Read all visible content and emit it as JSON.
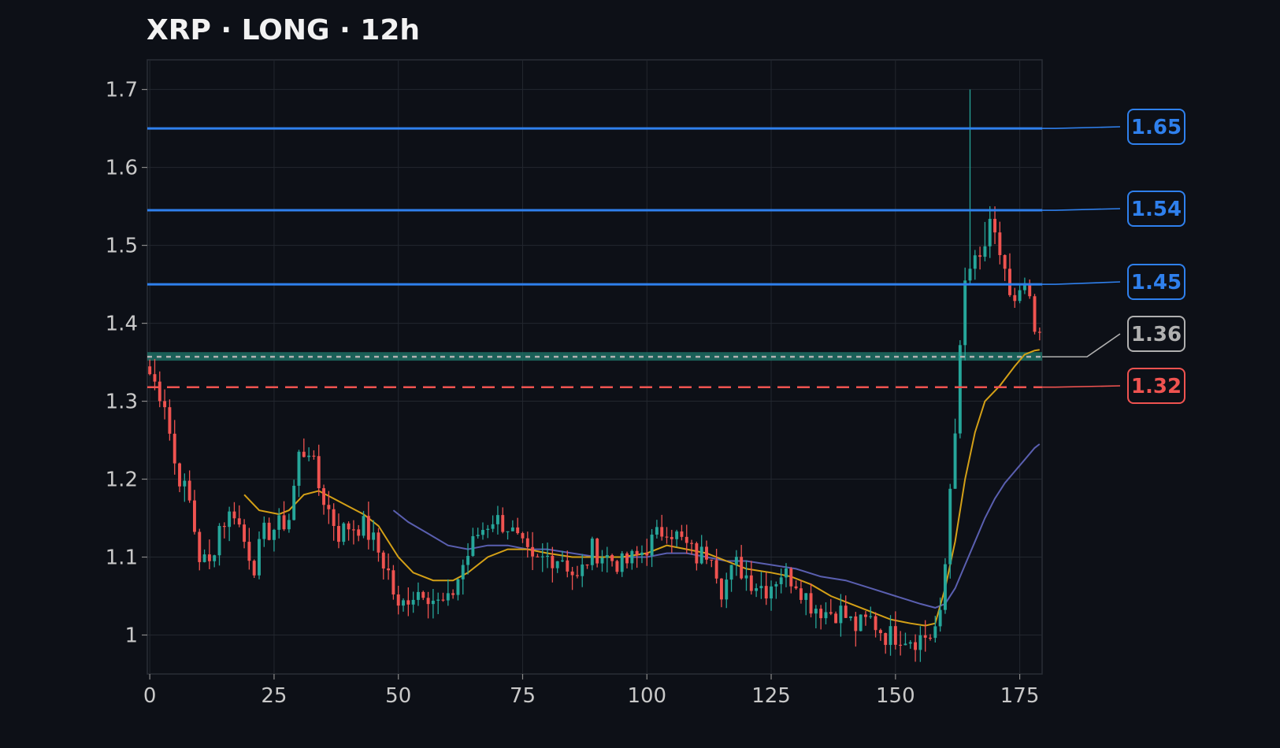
{
  "chart_data": {
    "type": "candlestick",
    "title": "XRP · LONG · 12h",
    "xlabel": "",
    "ylabel": "",
    "xlim": [
      -0.5,
      179.5
    ],
    "ylim": [
      0.95,
      1.738
    ],
    "x_ticks": [
      0,
      25,
      50,
      75,
      100,
      125,
      150,
      175
    ],
    "y_ticks": [
      1,
      1.1,
      1.2,
      1.3,
      1.4,
      1.5,
      1.6,
      1.7
    ],
    "y_tick_labels": [
      "1",
      "1.1",
      "1.2",
      "1.3",
      "1.4",
      "1.5",
      "1.6",
      "1.7"
    ],
    "grid": true,
    "colors": {
      "up": "#26a69a",
      "down": "#ef5350",
      "take_profit": "#2f80ed",
      "stop_loss": "#ef5350",
      "entry": "#b0b0b0",
      "entry_zone": "#1f7a6e",
      "ma_fast": "#d4a017",
      "ma_slow": "#5a5fb0",
      "background": "#0d1017",
      "plot_bg": "#0d1017",
      "grid": "#23272f"
    },
    "levels": [
      {
        "role": "take-profit-3",
        "value": 1.65,
        "label": "1.65",
        "color": "#2f80ed",
        "style": "solid"
      },
      {
        "role": "take-profit-2",
        "value": 1.545,
        "label": "1.54",
        "color": "#2f80ed",
        "style": "solid"
      },
      {
        "role": "take-profit-1",
        "value": 1.45,
        "label": "1.45",
        "color": "#2f80ed",
        "style": "solid"
      },
      {
        "role": "entry",
        "value": 1.357,
        "label": "1.36",
        "color": "#b0b0b0",
        "style": "dotted"
      },
      {
        "role": "stop-loss",
        "value": 1.318,
        "label": "1.32",
        "color": "#ef5350",
        "style": "dashed"
      }
    ],
    "entry_zone": {
      "low": 1.352,
      "high": 1.363
    },
    "anchors": [
      [
        0,
        1.335
      ],
      [
        3,
        1.3
      ],
      [
        5,
        1.22
      ],
      [
        8,
        1.17
      ],
      [
        10,
        1.1
      ],
      [
        12,
        1.09
      ],
      [
        14,
        1.14
      ],
      [
        17,
        1.16
      ],
      [
        19,
        1.12
      ],
      [
        21,
        1.09
      ],
      [
        23,
        1.13
      ],
      [
        26,
        1.14
      ],
      [
        28,
        1.15
      ],
      [
        30,
        1.23
      ],
      [
        32,
        1.24
      ],
      [
        34,
        1.19
      ],
      [
        36,
        1.16
      ],
      [
        38,
        1.13
      ],
      [
        40,
        1.14
      ],
      [
        43,
        1.14
      ],
      [
        45,
        1.12
      ],
      [
        48,
        1.08
      ],
      [
        50,
        1.03
      ],
      [
        52,
        1.05
      ],
      [
        55,
        1.06
      ],
      [
        58,
        1.04
      ],
      [
        60,
        1.04
      ],
      [
        63,
        1.09
      ],
      [
        66,
        1.13
      ],
      [
        69,
        1.15
      ],
      [
        72,
        1.14
      ],
      [
        75,
        1.11
      ],
      [
        77,
        1.09
      ],
      [
        80,
        1.1
      ],
      [
        83,
        1.1
      ],
      [
        86,
        1.07
      ],
      [
        89,
        1.11
      ],
      [
        92,
        1.1
      ],
      [
        95,
        1.09
      ],
      [
        98,
        1.1
      ],
      [
        101,
        1.12
      ],
      [
        104,
        1.14
      ],
      [
        107,
        1.12
      ],
      [
        110,
        1.1
      ],
      [
        113,
        1.11
      ],
      [
        115,
        1.06
      ],
      [
        118,
        1.09
      ],
      [
        121,
        1.07
      ],
      [
        124,
        1.06
      ],
      [
        127,
        1.08
      ],
      [
        130,
        1.07
      ],
      [
        133,
        1.04
      ],
      [
        136,
        1.03
      ],
      [
        139,
        1.03
      ],
      [
        142,
        1.01
      ],
      [
        145,
        1.02
      ],
      [
        148,
        1.0
      ],
      [
        151,
        1.0
      ],
      [
        154,
        0.995
      ],
      [
        157,
        1.0
      ],
      [
        159,
        1.02
      ],
      [
        160,
        1.09
      ],
      [
        161,
        1.19
      ],
      [
        162,
        1.27
      ],
      [
        163,
        1.36
      ],
      [
        164,
        1.45
      ],
      [
        165,
        1.47
      ],
      [
        167,
        1.48
      ],
      [
        169,
        1.52
      ],
      [
        171,
        1.49
      ],
      [
        172,
        1.47
      ],
      [
        173,
        1.43
      ],
      [
        174,
        1.42
      ],
      [
        175,
        1.43
      ],
      [
        176,
        1.45
      ],
      [
        177,
        1.42
      ],
      [
        178,
        1.385
      ],
      [
        179,
        1.378
      ]
    ],
    "spikes": [
      {
        "x": 165,
        "high": 1.7
      },
      {
        "x": 170,
        "high": 1.55
      },
      {
        "x": 168,
        "high": 1.53
      }
    ],
    "ma_fast_start": 19,
    "ma_fast": [
      [
        19,
        1.18
      ],
      [
        22,
        1.16
      ],
      [
        26,
        1.155
      ],
      [
        28,
        1.16
      ],
      [
        31,
        1.18
      ],
      [
        34,
        1.185
      ],
      [
        37,
        1.175
      ],
      [
        40,
        1.165
      ],
      [
        43,
        1.155
      ],
      [
        46,
        1.14
      ],
      [
        50,
        1.1
      ],
      [
        53,
        1.08
      ],
      [
        57,
        1.07
      ],
      [
        61,
        1.07
      ],
      [
        64,
        1.08
      ],
      [
        68,
        1.1
      ],
      [
        72,
        1.11
      ],
      [
        76,
        1.11
      ],
      [
        80,
        1.105
      ],
      [
        85,
        1.1
      ],
      [
        90,
        1.1
      ],
      [
        95,
        1.1
      ],
      [
        100,
        1.105
      ],
      [
        104,
        1.115
      ],
      [
        108,
        1.11
      ],
      [
        112,
        1.105
      ],
      [
        116,
        1.095
      ],
      [
        120,
        1.085
      ],
      [
        125,
        1.08
      ],
      [
        129,
        1.075
      ],
      [
        133,
        1.065
      ],
      [
        137,
        1.05
      ],
      [
        141,
        1.04
      ],
      [
        145,
        1.03
      ],
      [
        149,
        1.02
      ],
      [
        153,
        1.015
      ],
      [
        156,
        1.012
      ],
      [
        158,
        1.015
      ],
      [
        160,
        1.06
      ],
      [
        162,
        1.12
      ],
      [
        164,
        1.2
      ],
      [
        166,
        1.26
      ],
      [
        168,
        1.3
      ],
      [
        171,
        1.32
      ],
      [
        174,
        1.345
      ],
      [
        176,
        1.36
      ],
      [
        178,
        1.365
      ],
      [
        179,
        1.366
      ]
    ],
    "ma_slow_start": 49,
    "ma_slow": [
      [
        49,
        1.16
      ],
      [
        52,
        1.145
      ],
      [
        56,
        1.13
      ],
      [
        60,
        1.115
      ],
      [
        64,
        1.11
      ],
      [
        68,
        1.115
      ],
      [
        72,
        1.115
      ],
      [
        76,
        1.11
      ],
      [
        80,
        1.11
      ],
      [
        85,
        1.105
      ],
      [
        90,
        1.1
      ],
      [
        95,
        1.1
      ],
      [
        100,
        1.1
      ],
      [
        104,
        1.105
      ],
      [
        108,
        1.105
      ],
      [
        112,
        1.1
      ],
      [
        116,
        1.095
      ],
      [
        120,
        1.095
      ],
      [
        125,
        1.09
      ],
      [
        130,
        1.085
      ],
      [
        135,
        1.075
      ],
      [
        140,
        1.07
      ],
      [
        145,
        1.06
      ],
      [
        150,
        1.05
      ],
      [
        155,
        1.04
      ],
      [
        158,
        1.035
      ],
      [
        160,
        1.04
      ],
      [
        162,
        1.06
      ],
      [
        164,
        1.09
      ],
      [
        166,
        1.12
      ],
      [
        168,
        1.15
      ],
      [
        170,
        1.175
      ],
      [
        172,
        1.195
      ],
      [
        174,
        1.21
      ],
      [
        176,
        1.225
      ],
      [
        178,
        1.24
      ],
      [
        179,
        1.245
      ]
    ]
  }
}
